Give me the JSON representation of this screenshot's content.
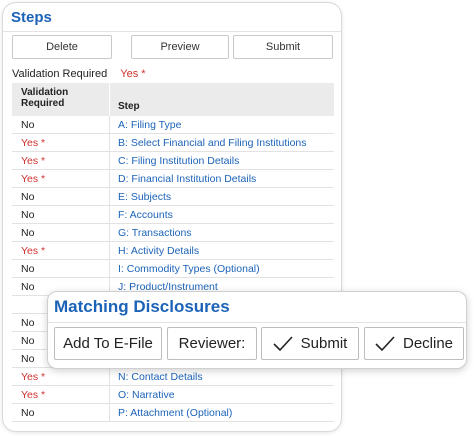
{
  "steps": {
    "title": "Steps",
    "toolbar": {
      "delete_label": "Delete",
      "preview_label": "Preview",
      "submit_label": "Submit"
    },
    "validation_summary": {
      "label": "Validation Required",
      "value": "Yes *"
    },
    "table": {
      "headers": {
        "validation_line1": "Validation",
        "validation_line2": "Required",
        "step": "Step"
      },
      "rows": [
        {
          "validation": "No",
          "step": "A: Filing Type"
        },
        {
          "validation": "Yes *",
          "step": "B: Select Financial and Filing Institutions"
        },
        {
          "validation": "Yes *",
          "step": "C: Filing Institution Details"
        },
        {
          "validation": "Yes *",
          "step": "D: Financial Institution Details"
        },
        {
          "validation": "No",
          "step": "E: Subjects"
        },
        {
          "validation": "No",
          "step": "F: Accounts"
        },
        {
          "validation": "No",
          "step": "G: Transactions"
        },
        {
          "validation": "Yes *",
          "step": "H: Activity Details"
        },
        {
          "validation": "No",
          "step": "I: Commodity Types (Optional)"
        },
        {
          "validation": "No",
          "step": "J: Product/Instrument"
        },
        {
          "validation": "",
          "step": ""
        },
        {
          "validation": "No",
          "step": ""
        },
        {
          "validation": "No",
          "step": ""
        },
        {
          "validation": "No",
          "step": ""
        },
        {
          "validation": "Yes *",
          "step": "N: Contact Details"
        },
        {
          "validation": "Yes *",
          "step": "O: Narrative"
        },
        {
          "validation": "No",
          "step": "P: Attachment (Optional)"
        }
      ]
    }
  },
  "disclosures": {
    "title": "Matching Disclosures",
    "add_label": "Add To E-File",
    "reviewer_label": "Reviewer:",
    "submit_label": "Submit",
    "decline_label": "Decline"
  },
  "colors": {
    "accent_blue": "#1c63b8",
    "required_red": "#d0312d"
  }
}
